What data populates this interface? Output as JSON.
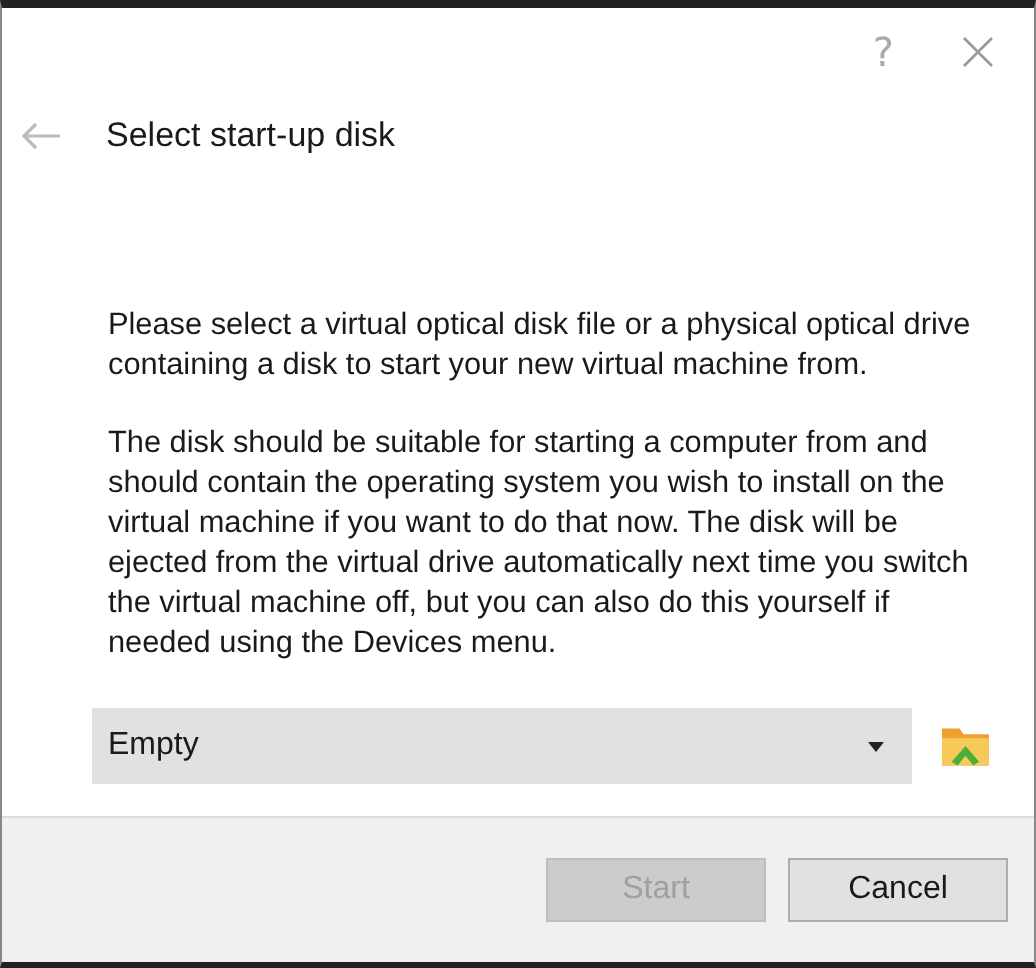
{
  "window": {
    "help": "?"
  },
  "page": {
    "title": "Select start-up disk",
    "paragraphs": [
      "Please select a virtual optical disk file or a physical optical drive containing a disk to start your new virtual machine from.",
      "The disk should be suitable for starting a computer from and should contain the operating system you wish to install on the virtual machine if you want to do that now. The disk will be ejected from the virtual drive automatically next time you switch the virtual machine off, but you can also do this yourself if needed using the Devices menu."
    ]
  },
  "disk_select": {
    "value": "Empty"
  },
  "buttons": [
    {
      "label": "Start",
      "disabled": true
    },
    {
      "label": "Cancel",
      "disabled": false
    }
  ]
}
